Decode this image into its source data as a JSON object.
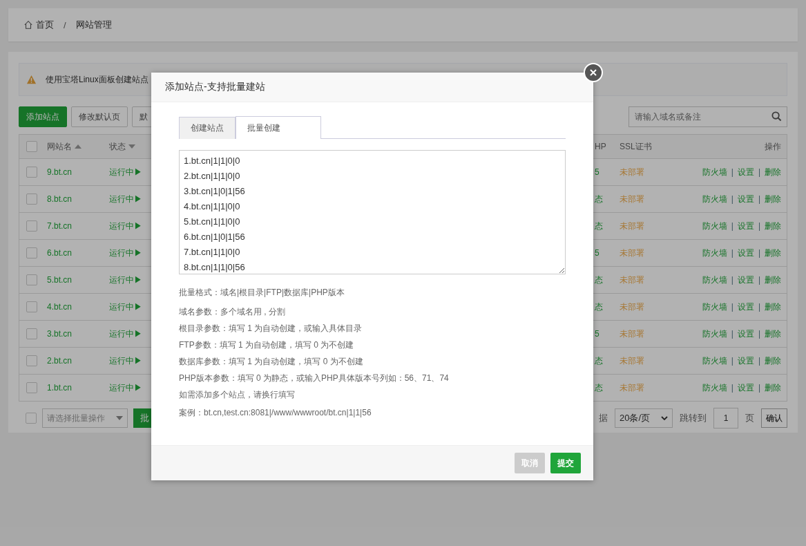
{
  "breadcrumb": {
    "home": "首页",
    "separator": "/",
    "current": "网站管理"
  },
  "alert": {
    "text": "使用宝塔Linux面板创建站点"
  },
  "toolbar": {
    "buttons": [
      {
        "label": "添加站点",
        "kind": "primary"
      },
      {
        "label": "修改默认页",
        "kind": "default"
      },
      {
        "label": "默",
        "kind": "default"
      }
    ],
    "search": {
      "placeholder": "请输入域名或备注"
    }
  },
  "table": {
    "action_separator": "|",
    "header": {
      "checked": false,
      "name": "网站名",
      "status": "状态",
      "php": "HP",
      "ssl": "SSL证书",
      "actions": "操作"
    },
    "rows": [
      {
        "checked": false,
        "name": "9.bt.cn",
        "status": "运行中▶",
        "php": "5",
        "ssl": "未部署",
        "actions": [
          "防火墙",
          "设置",
          "删除"
        ]
      },
      {
        "checked": false,
        "name": "8.bt.cn",
        "status": "运行中▶",
        "php": "态",
        "ssl": "未部署",
        "actions": [
          "防火墙",
          "设置",
          "删除"
        ]
      },
      {
        "checked": false,
        "name": "7.bt.cn",
        "status": "运行中▶",
        "php": "态",
        "ssl": "未部署",
        "actions": [
          "防火墙",
          "设置",
          "删除"
        ]
      },
      {
        "checked": false,
        "name": "6.bt.cn",
        "status": "运行中▶",
        "php": "5",
        "ssl": "未部署",
        "actions": [
          "防火墙",
          "设置",
          "删除"
        ]
      },
      {
        "checked": false,
        "name": "5.bt.cn",
        "status": "运行中▶",
        "php": "态",
        "ssl": "未部署",
        "actions": [
          "防火墙",
          "设置",
          "删除"
        ]
      },
      {
        "checked": false,
        "name": "4.bt.cn",
        "status": "运行中▶",
        "php": "态",
        "ssl": "未部署",
        "actions": [
          "防火墙",
          "设置",
          "删除"
        ]
      },
      {
        "checked": false,
        "name": "3.bt.cn",
        "status": "运行中▶",
        "php": "5",
        "ssl": "未部署",
        "actions": [
          "防火墙",
          "设置",
          "删除"
        ]
      },
      {
        "checked": false,
        "name": "2.bt.cn",
        "status": "运行中▶",
        "php": "态",
        "ssl": "未部署",
        "actions": [
          "防火墙",
          "设置",
          "删除"
        ]
      },
      {
        "checked": false,
        "name": "1.bt.cn",
        "status": "运行中▶",
        "php": "态",
        "ssl": "未部署",
        "actions": [
          "防火墙",
          "设置",
          "删除"
        ]
      }
    ]
  },
  "footer": {
    "checked": false,
    "batch_placeholder": "请选择批量操作",
    "batch_button": "批",
    "count_partial": "据",
    "page_size": "20条/页",
    "goto_label": "跳转到",
    "page": "1",
    "page_unit": "页",
    "confirm": "确认"
  },
  "dialog": {
    "title": "添加站点-支持批量建站",
    "tabs": [
      {
        "label": "创建站点",
        "selected": false
      },
      {
        "label": "批量创建",
        "selected": true
      }
    ],
    "textarea_lines": [
      "1.bt.cn|1|1|0|0",
      "2.bt.cn|1|1|0|0",
      "3.bt.cn|1|0|1|56",
      "4.bt.cn|1|1|0|0",
      "5.bt.cn|1|1|0|0",
      "6.bt.cn|1|0|1|56",
      "7.bt.cn|1|1|0|0",
      "8.bt.cn|1|1|0|56"
    ],
    "format": "批量格式：域名|根目录|FTP|数据库|PHP版本",
    "help": [
      "域名参数：多个域名用 , 分割",
      "根目录参数：填写 1 为自动创建，或输入具体目录",
      "FTP参数：填写 1 为自动创建，填写 0 为不创建",
      "数据库参数：填写 1 为自动创建，填写 0 为不创建",
      "PHP版本参数：填写 0 为静态，或输入PHP具体版本号列如：56、71、74",
      "如需添加多个站点，请换行填写"
    ],
    "example": "案例：bt.cn,test.cn:8081|/www/wwwroot/bt.cn|1|1|56",
    "buttons": [
      {
        "label": "取消",
        "kind": "cancel"
      },
      {
        "label": "提交",
        "kind": "submit"
      }
    ]
  }
}
